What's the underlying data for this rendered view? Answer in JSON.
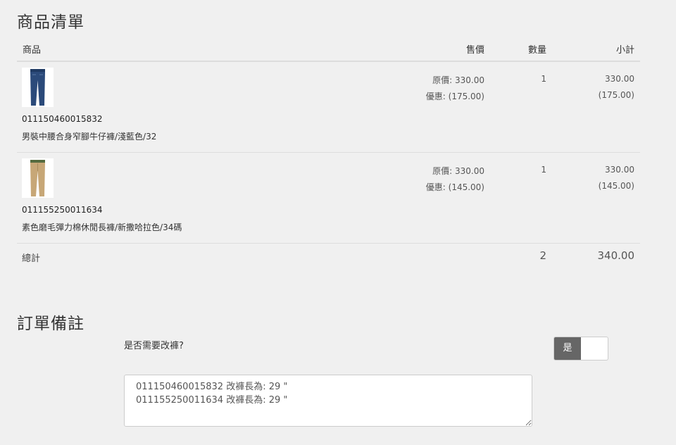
{
  "sections": {
    "list_title": "商品清單",
    "note_title": "訂單備註"
  },
  "table": {
    "headers": {
      "product": "商品",
      "price": "售價",
      "qty": "數量",
      "subtotal": "小計"
    },
    "rows": [
      {
        "sku": "011150460015832",
        "name": "男裝中腰合身窄腳牛仔褲/淺藍色/32",
        "original_price": "原價: 330.00",
        "discount": "優惠: (175.00)",
        "qty": "1",
        "subtotal": "330.00",
        "subtotal_discount": "(175.00)",
        "image": "jeans-image",
        "color": "#2b4a7a"
      },
      {
        "sku": "011155250011634",
        "name": "素色磨毛彈力棉休閒長褲/新撒哈拉色/34碼",
        "original_price": "原價: 330.00",
        "discount": "優惠: (145.00)",
        "qty": "1",
        "subtotal": "330.00",
        "subtotal_discount": "(145.00)",
        "image": "khaki-pants-image",
        "color": "#c7a777"
      }
    ],
    "total": {
      "label": "總計",
      "qty": "2",
      "amount": "340.00"
    }
  },
  "note": {
    "question": "是否需要改褲?",
    "toggle_label": "是",
    "toggle_on": true,
    "textarea_value": "011150460015832 改褲長為: 29 \"\n011155250011634 改褲長為: 29 \""
  }
}
